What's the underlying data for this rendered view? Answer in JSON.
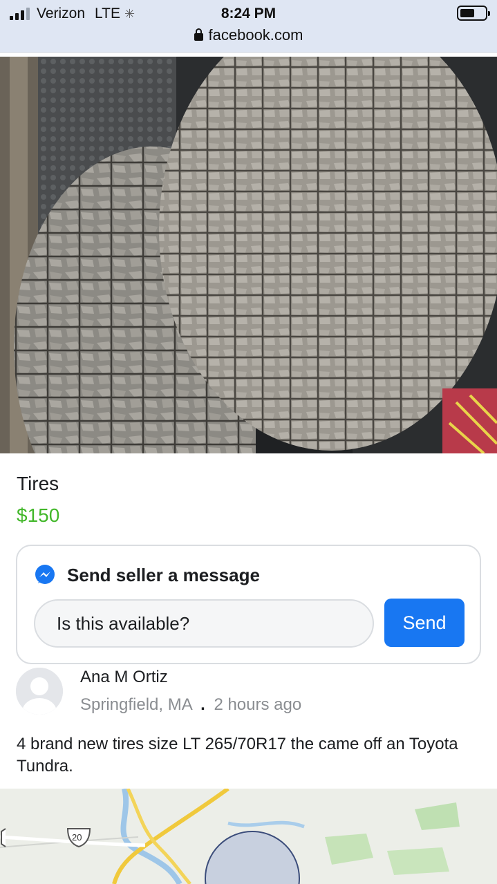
{
  "status_bar": {
    "carrier": "Verizon",
    "network": "LTE",
    "time": "8:24 PM",
    "url": "facebook.com"
  },
  "listing": {
    "title": "Tires",
    "price": "$150",
    "description": "4 brand new tires size LT 265/70R17 the came off an Toyota Tundra."
  },
  "message": {
    "header": "Send seller a message",
    "input_value": "Is this available?",
    "send_label": "Send"
  },
  "seller": {
    "name": "Ana M Ortiz",
    "location": "Springfield, MA",
    "separator": ".",
    "posted": "2 hours ago"
  },
  "map": {
    "route_shield": "20"
  },
  "colors": {
    "status_bg": "#dfe6f3",
    "price_green": "#42b72a",
    "send_blue": "#1877f2",
    "messenger_blue": "#1877f2"
  }
}
